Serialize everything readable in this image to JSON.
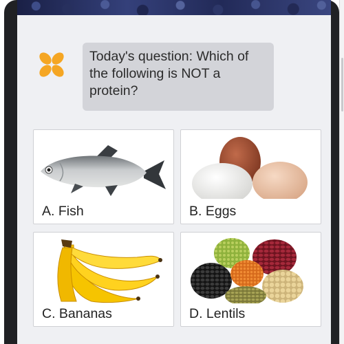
{
  "colors": {
    "screen_bg": "#eff0f3",
    "bubble_bg": "#d3d4d9",
    "logo_orange": "#f5a623",
    "card_border": "#cfd0d4",
    "device_frame": "#202124"
  },
  "header": {
    "logo_icon": "flower-logo-icon"
  },
  "question": {
    "text": "Today's question: Which of the following is NOT a protein?"
  },
  "options": [
    {
      "label": "A. Fish",
      "image": "fish-image"
    },
    {
      "label": "B. Eggs",
      "image": "eggs-image"
    },
    {
      "label": "C. Bananas",
      "image": "bananas-image"
    },
    {
      "label": "D. Lentils",
      "image": "lentils-image"
    }
  ]
}
